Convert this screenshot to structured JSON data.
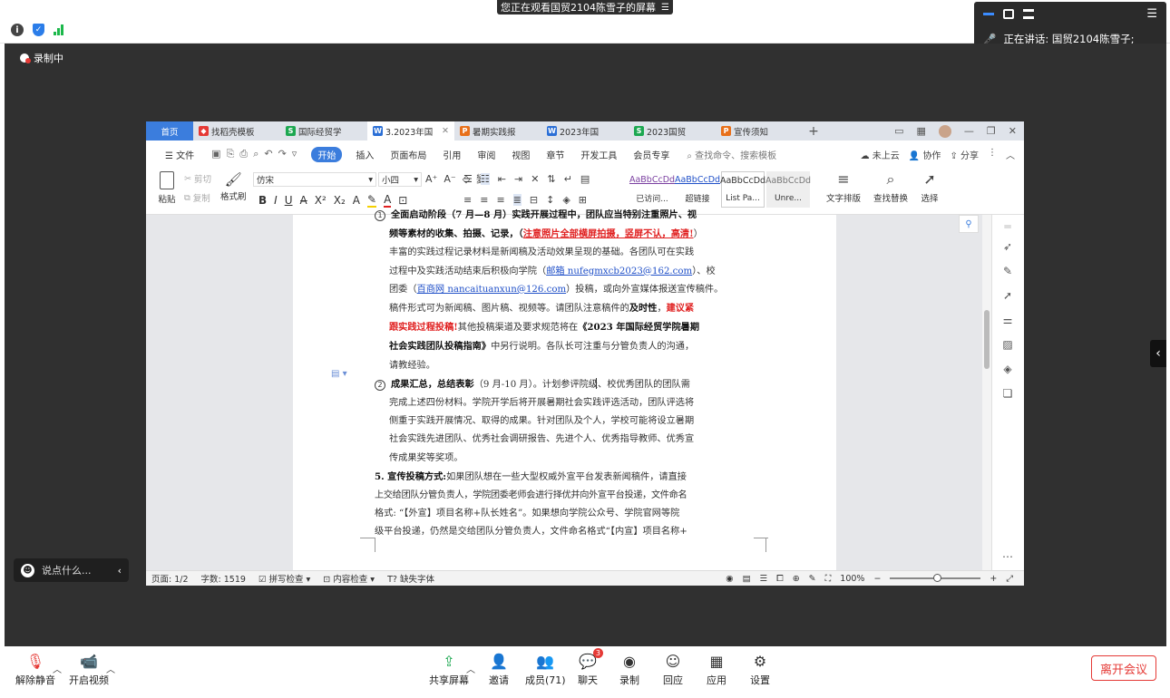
{
  "screen_share": {
    "banner": "您正在观看国贸2104陈雪子的屏幕",
    "recording": "录制中",
    "speaking_label": "正在讲话: 国贸2104陈雪子;",
    "chat_placeholder": "说点什么..."
  },
  "wps": {
    "tabs": [
      {
        "label": "首页",
        "icon": ""
      },
      {
        "label": "找稻壳模板",
        "icon": "docer-icon",
        "color": "#e53935"
      },
      {
        "label": "国际经贸学",
        "icon": "S",
        "color": "#1da851"
      },
      {
        "label": "3.2023年国",
        "icon": "W",
        "color": "#2b6fd6"
      },
      {
        "label": "暑期实践报",
        "icon": "P",
        "color": "#e8701a"
      },
      {
        "label": "2023年国",
        "icon": "W",
        "color": "#2b6fd6"
      },
      {
        "label": "2023国贸",
        "icon": "S",
        "color": "#1da851"
      },
      {
        "label": "宣传须知",
        "icon": "P",
        "color": "#e8701a"
      }
    ],
    "menu": [
      "文件",
      "开始",
      "插入",
      "页面布局",
      "引用",
      "审阅",
      "视图",
      "章节",
      "开发工具",
      "会员专享"
    ],
    "search_hint": "查找命令、搜索模板",
    "menu_right": [
      "未上云",
      "协作",
      "分享"
    ],
    "ribbon": {
      "paste": "粘贴",
      "cut": "剪切",
      "copy": "复制",
      "format_painter": "格式刷",
      "font": "仿宋",
      "size": "小四",
      "styles": [
        {
          "preview": "AaBbCcDd",
          "name": "已访问..."
        },
        {
          "preview": "AaBbCcDd",
          "name": "超链接"
        },
        {
          "preview": "AaBbCcDd",
          "name": "List Pa..."
        },
        {
          "preview": "AaBbCcDd",
          "name": "Unre..."
        }
      ],
      "tools": [
        "文字排版",
        "查找替换",
        "选择"
      ]
    },
    "doc": {
      "p1_line1": "全面启动阶段（7 月—8 月）实践开展过程中，团队应当特别注重照片、视",
      "p1_line2a": "频等素材的收集、拍摄、记录，（",
      "p1_line2red": "注意照片全部横屏拍摄，竖屏不认，高清!",
      "p1_line2b": "）",
      "p1_line3": "丰富的实践过程记录材料是新闻稿及活动效果呈现的基础。各团队可在实践",
      "p1_line4a": "过程中及实践活动结束后积极向学院（",
      "p1_line4link": "邮箱 nufegmxcb2023@162.com",
      "p1_line4b": "）、校",
      "p1_line5a": "团委（",
      "p1_line5link": "百商网 nancaituanxun@126.com",
      "p1_line5b": "）投稿，或向外宣媒体报送宣传稿件。",
      "p1_line6a": "稿件形式可为新闻稿、图片稿、视频等。请团队注意稿件的",
      "p1_line6b": "及时性",
      "p1_line6c": "，",
      "p1_line6red": "建议紧",
      "p1_line7red": "跟实践过程投稿!",
      "p1_line7a": "其他投稿渠道及要求规范将在",
      "p1_line7b": "《2023 年国际经贸学院暑期",
      "p1_line8b": "社会实践团队投稿指南》",
      "p1_line8a": "中另行说明。各队长可注重与分管负责人的沟通，",
      "p1_line9": "请教经验。",
      "p2_num": "2",
      "p1_num": "1",
      "p2_line1b": "成果汇总，总结表彰",
      "p2_line1a": "（9 月-10 月）。计划参评院级、校优秀团队的团队需",
      "p2_line2": "完成上述四份材料。学院开学后将开展暑期社会实践评选活动，团队评选将",
      "p2_line3": "侧重于实践开展情况、取得的成果。针对团队及个人，学校可能将设立暑期",
      "p2_line4": "社会实践先进团队、优秀社会调研报告、先进个人、优秀指导教师、优秀宣",
      "p2_line5": "传成果奖等奖项。",
      "p3_line1b": "5. 宣传投稿方式:",
      "p3_line1a": "如果团队想在一些大型权威外宣平台发表新闻稿件，请直接",
      "p3_line2": "上交给团队分管负责人，学院团委老师会进行择优并向外宣平台投递，文件命名",
      "p3_line3": "格式: “【外宣】项目名称+队长姓名”。如果想向学院公众号、学院官网等院",
      "p3_line4": "级平台投递，仍然是交给团队分管负责人，文件命名格式“【内宣】项目名称+"
    },
    "status": {
      "page": "页面: 1/2",
      "words": "字数: 1519",
      "spell": "拼写检查",
      "content_check": "内容检查",
      "missing_font": "缺失字体",
      "zoom": "100%"
    }
  },
  "meeting_toolbar": {
    "unmute": "解除静音",
    "video": "开启视频",
    "share": "共享屏幕",
    "invite": "邀请",
    "members": "成员(71)",
    "chat": "聊天",
    "chat_badge": "3",
    "record": "录制",
    "reply": "回应",
    "apps": "应用",
    "settings": "设置",
    "leave": "离开会议"
  }
}
